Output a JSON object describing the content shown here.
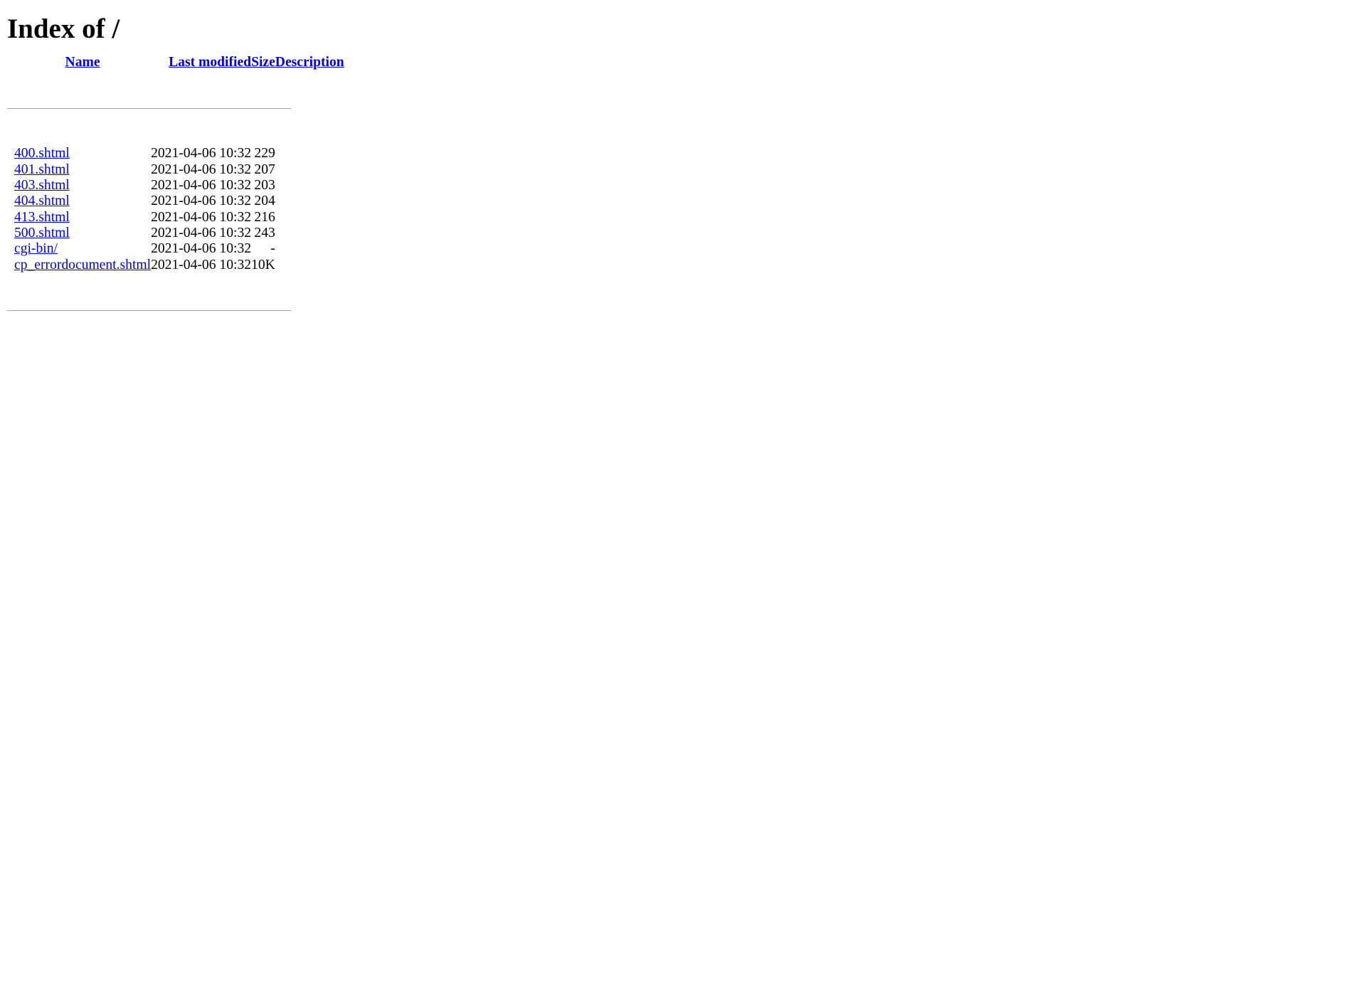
{
  "page": {
    "title": "Index of /"
  },
  "table": {
    "headers": {
      "icon": "",
      "name": "Name",
      "modified": "Last modified",
      "size": "Size",
      "description": "Description"
    },
    "rows": [
      {
        "name": "400.shtml",
        "modified": "2021-04-06 10:32",
        "size": "229",
        "description": ""
      },
      {
        "name": "401.shtml",
        "modified": "2021-04-06 10:32",
        "size": "207",
        "description": ""
      },
      {
        "name": "403.shtml",
        "modified": "2021-04-06 10:32",
        "size": "203",
        "description": ""
      },
      {
        "name": "404.shtml",
        "modified": "2021-04-06 10:32",
        "size": "204",
        "description": ""
      },
      {
        "name": "413.shtml",
        "modified": "2021-04-06 10:32",
        "size": "216",
        "description": ""
      },
      {
        "name": "500.shtml",
        "modified": "2021-04-06 10:32",
        "size": "243",
        "description": ""
      },
      {
        "name": "cgi-bin/",
        "modified": "2021-04-06 10:32",
        "size": "-",
        "description": ""
      },
      {
        "name": "cp_errordocument.shtml",
        "modified": "2021-04-06 10:32",
        "size": "10K",
        "description": ""
      }
    ]
  },
  "colors": {
    "link": "#0000EE",
    "text": "#000000",
    "background": "#FFFFFF",
    "rule": "#A0A0A0"
  }
}
